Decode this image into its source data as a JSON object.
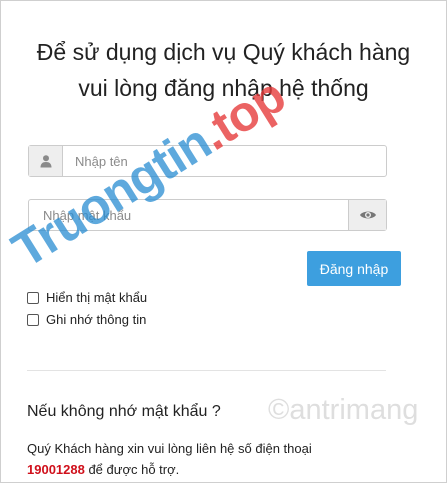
{
  "login": {
    "title": "Để sử dụng dịch vụ Quý khách hàng vui lòng đăng nhập hệ thống",
    "username": {
      "value": "",
      "placeholder": "Nhập tên",
      "icon": "user-icon"
    },
    "password": {
      "value": "",
      "placeholder": "Nhập mật khẩu",
      "icon": "eye-icon"
    },
    "submit_label": "Đăng nhập",
    "show_password_label": "Hiển thị mật khẩu",
    "remember_label": "Ghi nhớ thông tin"
  },
  "help": {
    "title": "Nếu không nhớ mật khẩu ?",
    "text_before": "Quý Khách hàng xin vui lòng liên hệ số điện thoại",
    "phone": "19001288",
    "text_after": " để được hỗ trợ."
  },
  "watermark": {
    "main_text": "Truongtin",
    "dot": ".",
    "suffix": "top",
    "secondary": "©antrimang"
  },
  "colors": {
    "button": "#3d9fdf",
    "phone": "#d0101b"
  }
}
